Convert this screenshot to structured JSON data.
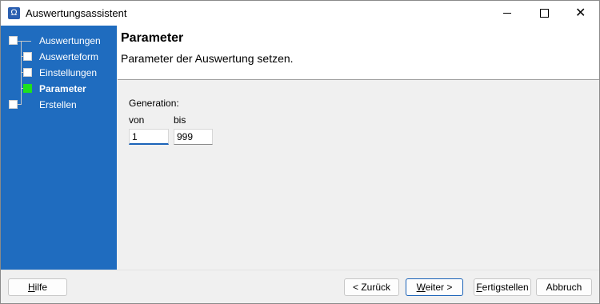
{
  "window": {
    "title": "Auswertungsassistent",
    "app_icon_glyph": "Ω",
    "controls": {
      "minimize_icon": "minimize-icon",
      "maximize_icon": "maximize-icon",
      "close_glyph": "✕"
    }
  },
  "sidebar": {
    "items": [
      {
        "label": "Auswertungen",
        "active": false
      },
      {
        "label": "Auswerteform",
        "active": false
      },
      {
        "label": "Einstellungen",
        "active": false
      },
      {
        "label": "Parameter",
        "active": true
      },
      {
        "label": "Erstellen",
        "active": false
      }
    ],
    "colors": {
      "background": "#1f6cbf",
      "active_node": "#1ee01e"
    }
  },
  "header": {
    "title": "Parameter",
    "subtitle": "Parameter der Auswertung setzen."
  },
  "form": {
    "group_label": "Generation:",
    "from_label": "von",
    "to_label": "bis",
    "from_value": "1",
    "to_value": "999"
  },
  "footer": {
    "help": {
      "mnemonic": "H",
      "rest": "ilfe"
    },
    "back": {
      "text": "< Zurück"
    },
    "next": {
      "mnemonic": "W",
      "rest": "eiter >"
    },
    "finish": {
      "mnemonic": "F",
      "rest": "ertigstellen"
    },
    "cancel": {
      "text": "Abbruch"
    }
  }
}
